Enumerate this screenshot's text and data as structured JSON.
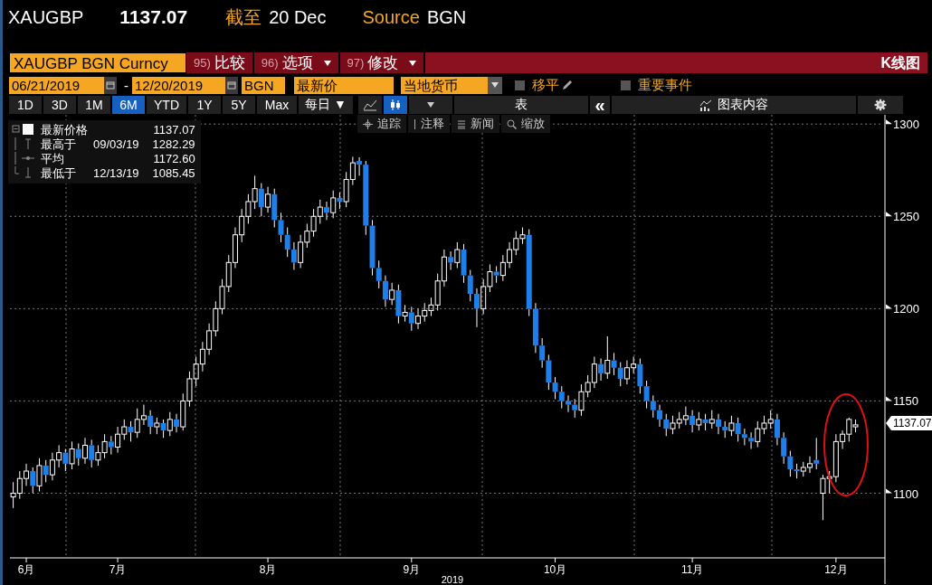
{
  "header": {
    "ticker": "XAUGBP",
    "price": "1137.07",
    "as_of_label": "截至",
    "as_of": "20 Dec",
    "source_label": "Source",
    "source": "BGN"
  },
  "command_bar": {
    "security": "XAUGBP BGN Curncy",
    "actions": [
      {
        "number": "95)",
        "label": "比较",
        "dropdown": false
      },
      {
        "number": "96)",
        "label": "选项",
        "dropdown": true
      },
      {
        "number": "97)",
        "label": "修改",
        "dropdown": true
      }
    ],
    "chart_type": "K线图"
  },
  "settings": {
    "start_date": "06/21/2019",
    "separator": "-",
    "end_date": "12/20/2019",
    "source": "BGN",
    "field": "最新价",
    "currency": "当地货币",
    "options": [
      {
        "label": "移平",
        "checked": false,
        "editable": true
      },
      {
        "label": "重要事件",
        "checked": false,
        "editable": false
      }
    ]
  },
  "periods": [
    {
      "label": "1D",
      "selected": false
    },
    {
      "label": "3D",
      "selected": false
    },
    {
      "label": "1M",
      "selected": false
    },
    {
      "label": "6M",
      "selected": true
    },
    {
      "label": "YTD",
      "selected": false
    },
    {
      "label": "1Y",
      "selected": false
    },
    {
      "label": "5Y",
      "selected": false
    },
    {
      "label": "Max",
      "selected": false
    }
  ],
  "frequency": "每日 ▼",
  "chart_styles": [
    {
      "kind": "line",
      "selected": false
    },
    {
      "kind": "candle",
      "selected": true
    }
  ],
  "table_button": "表",
  "collapse_button": "«",
  "chart_content_button": "图表内容",
  "chart_tools": [
    {
      "kind": "track",
      "label": "追踪"
    },
    {
      "kind": "note",
      "label": "注释"
    },
    {
      "kind": "news",
      "label": "新闻"
    },
    {
      "kind": "zoom",
      "label": "缩放"
    }
  ],
  "legend": [
    {
      "kind": "last",
      "label": "最新价格",
      "value": "1137.07"
    },
    {
      "kind": "high",
      "label": "最高于",
      "date": "09/03/19",
      "value": "1282.29"
    },
    {
      "kind": "average",
      "label": "平均",
      "value": "1172.60"
    },
    {
      "kind": "low",
      "label": "最低于",
      "date": "12/13/19",
      "value": "1085.45"
    }
  ],
  "last_price_tag": "1137.07",
  "chart_data": {
    "type": "candlestick",
    "xlabel": "2019",
    "categories": [
      null,
      null,
      "6月",
      null,
      null,
      null,
      null,
      null,
      null,
      null,
      null,
      null,
      null,
      null,
      null,
      null,
      "7月",
      null,
      null,
      null,
      null,
      null,
      null,
      null,
      null,
      null,
      null,
      null,
      null,
      null,
      null,
      null,
      null,
      null,
      null,
      null,
      null,
      null,
      null,
      "8月",
      null,
      null,
      null,
      null,
      null,
      null,
      null,
      null,
      null,
      null,
      null,
      null,
      null,
      null,
      null,
      null,
      null,
      null,
      null,
      null,
      null,
      "9月",
      null,
      null,
      null,
      null,
      null,
      null,
      null,
      null,
      null,
      null,
      null,
      null,
      null,
      null,
      null,
      null,
      null,
      null,
      null,
      null,
      null,
      "10月",
      null,
      null,
      null,
      null,
      null,
      null,
      null,
      null,
      null,
      null,
      null,
      null,
      null,
      null,
      null,
      null,
      null,
      null,
      null,
      null,
      "11月",
      null,
      null,
      null,
      null,
      null,
      null,
      null,
      null,
      null,
      null,
      null,
      null,
      null,
      null,
      null,
      null,
      null,
      null,
      null,
      null,
      null,
      "12月",
      null,
      null,
      null,
      null,
      null,
      null,
      null
    ],
    "ohlc": [
      [
        1098,
        1106,
        1092,
        1100
      ],
      [
        1100,
        1112,
        1097,
        1108
      ],
      [
        1108,
        1116,
        1104,
        1112
      ],
      [
        1112,
        1114,
        1100,
        1104
      ],
      [
        1104,
        1119,
        1101,
        1115
      ],
      [
        1115,
        1118,
        1106,
        1110
      ],
      [
        1110,
        1122,
        1107,
        1118
      ],
      [
        1118,
        1126,
        1114,
        1122
      ],
      [
        1122,
        1124,
        1112,
        1116
      ],
      [
        1116,
        1128,
        1113,
        1124
      ],
      [
        1124,
        1127,
        1115,
        1119
      ],
      [
        1119,
        1130,
        1116,
        1126
      ],
      [
        1126,
        1129,
        1114,
        1118
      ],
      [
        1118,
        1126,
        1115,
        1122
      ],
      [
        1122,
        1132,
        1119,
        1128
      ],
      [
        1128,
        1131,
        1121,
        1125
      ],
      [
        1125,
        1136,
        1122,
        1132
      ],
      [
        1132,
        1140,
        1129,
        1136
      ],
      [
        1136,
        1139,
        1128,
        1133
      ],
      [
        1133,
        1146,
        1130,
        1140
      ],
      [
        1140,
        1148,
        1137,
        1142
      ],
      [
        1142,
        1145,
        1132,
        1136
      ],
      [
        1136,
        1141,
        1132,
        1138
      ],
      [
        1138,
        1140,
        1130,
        1134
      ],
      [
        1134,
        1144,
        1131,
        1140
      ],
      [
        1140,
        1143,
        1133,
        1136
      ],
      [
        1136,
        1154,
        1134,
        1150
      ],
      [
        1150,
        1166,
        1147,
        1162
      ],
      [
        1162,
        1174,
        1158,
        1170
      ],
      [
        1170,
        1182,
        1166,
        1178
      ],
      [
        1178,
        1192,
        1175,
        1188
      ],
      [
        1188,
        1204,
        1185,
        1200
      ],
      [
        1200,
        1216,
        1197,
        1212
      ],
      [
        1212,
        1229,
        1209,
        1225
      ],
      [
        1225,
        1244,
        1222,
        1240
      ],
      [
        1240,
        1254,
        1236,
        1250
      ],
      [
        1250,
        1262,
        1246,
        1258
      ],
      [
        1258,
        1272,
        1254,
        1265
      ],
      [
        1265,
        1268,
        1250,
        1255
      ],
      [
        1255,
        1266,
        1252,
        1262
      ],
      [
        1262,
        1265,
        1244,
        1248
      ],
      [
        1248,
        1252,
        1236,
        1240
      ],
      [
        1240,
        1244,
        1228,
        1232
      ],
      [
        1232,
        1236,
        1221,
        1225
      ],
      [
        1225,
        1240,
        1222,
        1236
      ],
      [
        1236,
        1246,
        1233,
        1242
      ],
      [
        1242,
        1254,
        1239,
        1250
      ],
      [
        1250,
        1259,
        1246,
        1255
      ],
      [
        1255,
        1258,
        1248,
        1252
      ],
      [
        1252,
        1264,
        1249,
        1260
      ],
      [
        1260,
        1263,
        1254,
        1258
      ],
      [
        1258,
        1274,
        1255,
        1270
      ],
      [
        1270,
        1282.29,
        1267,
        1279
      ],
      [
        1280,
        1282,
        1272,
        1278
      ],
      [
        1278,
        1280,
        1240,
        1245
      ],
      [
        1245,
        1248,
        1218,
        1222
      ],
      [
        1222,
        1226,
        1211,
        1215
      ],
      [
        1215,
        1218,
        1201,
        1205
      ],
      [
        1205,
        1214,
        1202,
        1210
      ],
      [
        1210,
        1213,
        1192,
        1196
      ],
      [
        1196,
        1202,
        1193,
        1198
      ],
      [
        1198,
        1201,
        1188,
        1192
      ],
      [
        1192,
        1200,
        1189,
        1196
      ],
      [
        1196,
        1203,
        1193,
        1199
      ],
      [
        1199,
        1206,
        1196,
        1202
      ],
      [
        1202,
        1219,
        1199,
        1215
      ],
      [
        1215,
        1232,
        1212,
        1228
      ],
      [
        1228,
        1231,
        1221,
        1225
      ],
      [
        1225,
        1236,
        1222,
        1232
      ],
      [
        1232,
        1235,
        1214,
        1218
      ],
      [
        1218,
        1221,
        1204,
        1208
      ],
      [
        1208,
        1211,
        1190,
        1200
      ],
      [
        1200,
        1216,
        1197,
        1212
      ],
      [
        1212,
        1224,
        1209,
        1220
      ],
      [
        1220,
        1223,
        1214,
        1218
      ],
      [
        1218,
        1229,
        1215,
        1225
      ],
      [
        1225,
        1236,
        1222,
        1232
      ],
      [
        1232,
        1242,
        1229,
        1238
      ],
      [
        1238,
        1244,
        1235,
        1240
      ],
      [
        1240,
        1243,
        1196,
        1200
      ],
      [
        1200,
        1203,
        1176,
        1180
      ],
      [
        1180,
        1184,
        1168,
        1172
      ],
      [
        1172,
        1175,
        1156,
        1160
      ],
      [
        1160,
        1163,
        1151,
        1155
      ],
      [
        1155,
        1158,
        1146,
        1150
      ],
      [
        1150,
        1153,
        1144,
        1148
      ],
      [
        1148,
        1151,
        1141,
        1145
      ],
      [
        1145,
        1159,
        1142,
        1155
      ],
      [
        1155,
        1164,
        1152,
        1160
      ],
      [
        1160,
        1174,
        1157,
        1170
      ],
      [
        1170,
        1173,
        1161,
        1165
      ],
      [
        1165,
        1185,
        1162,
        1172
      ],
      [
        1172,
        1176,
        1164,
        1168
      ],
      [
        1168,
        1171,
        1158,
        1162
      ],
      [
        1162,
        1172,
        1159,
        1168
      ],
      [
        1168,
        1174,
        1165,
        1170
      ],
      [
        1170,
        1173,
        1154,
        1158
      ],
      [
        1158,
        1161,
        1146,
        1150
      ],
      [
        1150,
        1153,
        1141,
        1145
      ],
      [
        1145,
        1148,
        1136,
        1140
      ],
      [
        1140,
        1143,
        1131,
        1135
      ],
      [
        1135,
        1142,
        1132,
        1138
      ],
      [
        1138,
        1144,
        1135,
        1140
      ],
      [
        1140,
        1147,
        1137,
        1142
      ],
      [
        1142,
        1145,
        1133,
        1137
      ],
      [
        1137,
        1144,
        1134,
        1140
      ],
      [
        1140,
        1143,
        1134,
        1138
      ],
      [
        1138,
        1145,
        1135,
        1140
      ],
      [
        1140,
        1143,
        1132,
        1136
      ],
      [
        1136,
        1139,
        1130,
        1134
      ],
      [
        1134,
        1142,
        1131,
        1138
      ],
      [
        1138,
        1141,
        1128,
        1132
      ],
      [
        1132,
        1135,
        1126,
        1130
      ],
      [
        1130,
        1133,
        1124,
        1128
      ],
      [
        1128,
        1139,
        1125,
        1135
      ],
      [
        1135,
        1142,
        1132,
        1138
      ],
      [
        1138,
        1145,
        1135,
        1140
      ],
      [
        1140,
        1143,
        1126,
        1130
      ],
      [
        1130,
        1133,
        1116,
        1120
      ],
      [
        1120,
        1123,
        1109,
        1113
      ],
      [
        1113,
        1116,
        1108,
        1112
      ],
      [
        1112,
        1117,
        1109,
        1114
      ],
      [
        1114,
        1120,
        1111,
        1116
      ],
      [
        1118,
        1130,
        1113,
        1116
      ],
      [
        1100,
        1110,
        1085.45,
        1108
      ],
      [
        1108,
        1112,
        1100,
        1109
      ],
      [
        1109,
        1132,
        1106,
        1128
      ],
      [
        1128,
        1134,
        1124,
        1132
      ],
      [
        1132,
        1141,
        1128,
        1140
      ],
      [
        1136,
        1140,
        1133,
        1137.07
      ],
      null,
      null,
      null,
      null
    ],
    "ylim": [
      1065,
      1305
    ],
    "grid": true,
    "yticks": [
      1100,
      1150,
      1200,
      1250,
      1300
    ]
  }
}
